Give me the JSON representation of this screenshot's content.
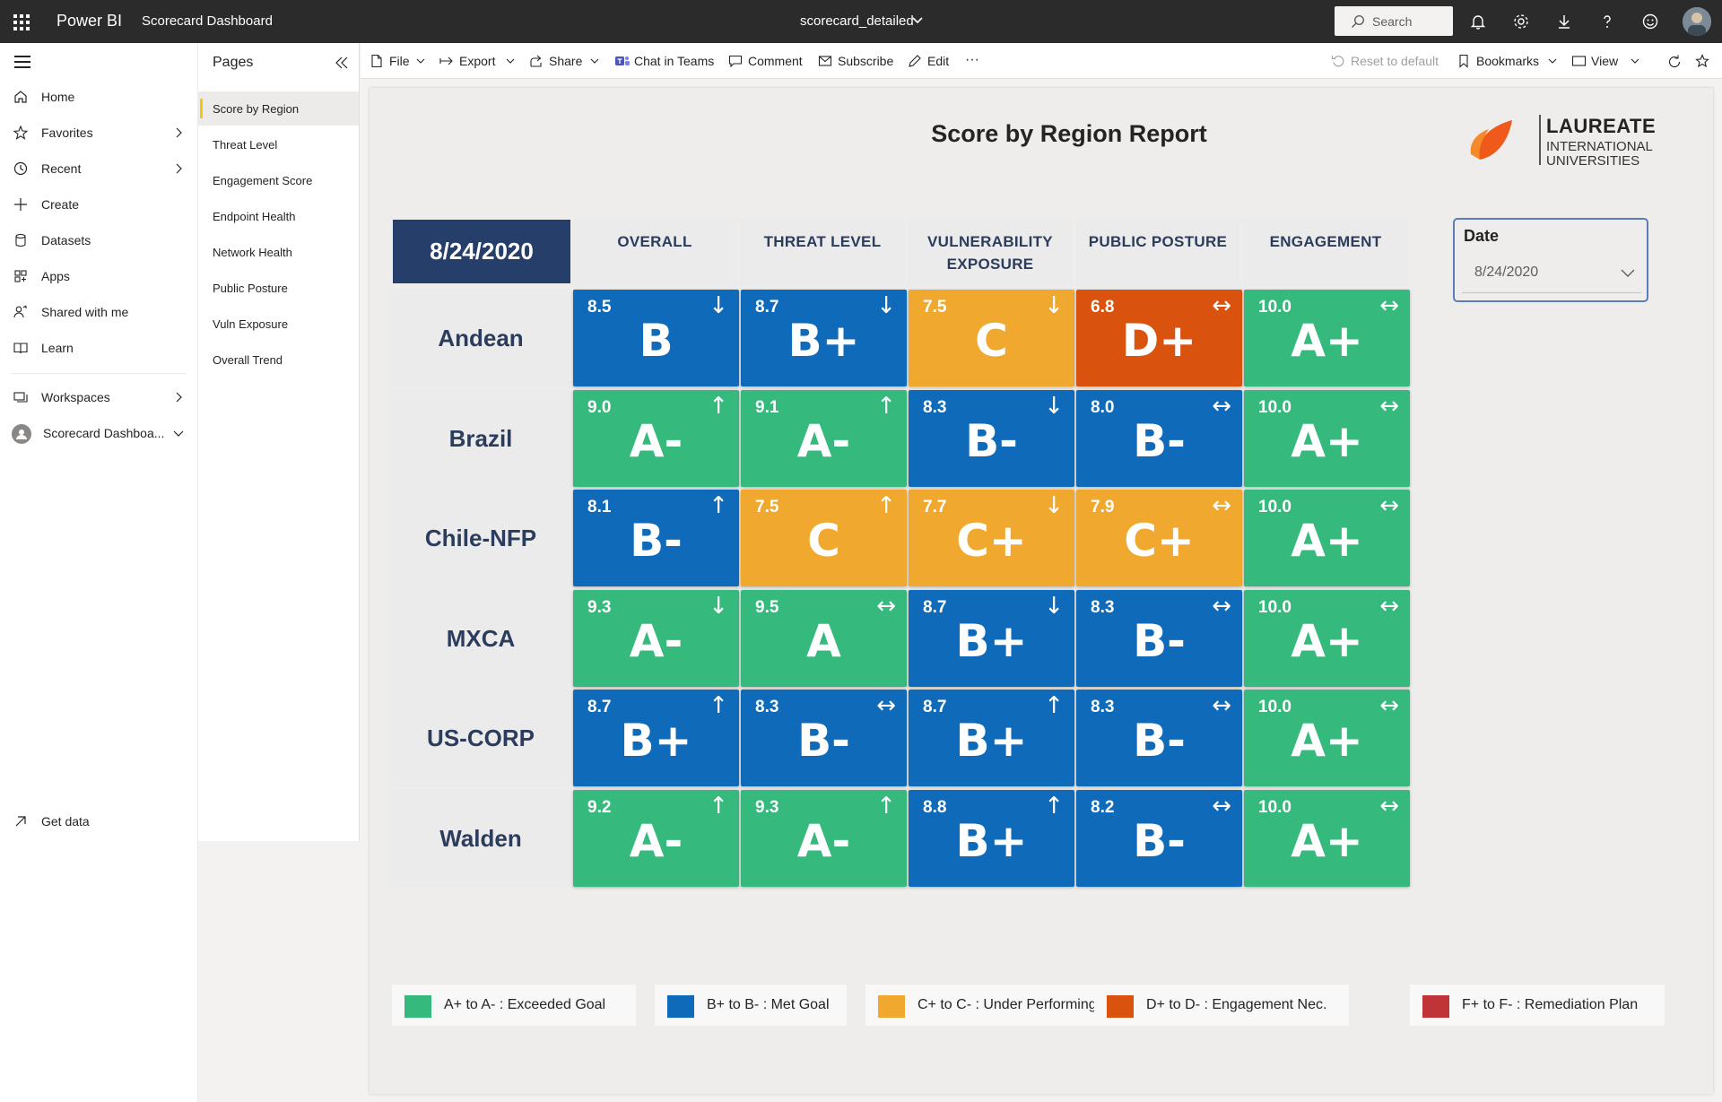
{
  "topbar": {
    "app_name": "Power BI",
    "report_title": "Scorecard Dashboard",
    "file_name": "scorecard_detailed",
    "search_placeholder": "Search"
  },
  "leftnav": {
    "items": [
      {
        "label": "Home",
        "icon": "home-icon"
      },
      {
        "label": "Favorites",
        "icon": "star-icon"
      },
      {
        "label": "Recent",
        "icon": "clock-icon"
      },
      {
        "label": "Create",
        "icon": "plus-icon"
      },
      {
        "label": "Datasets",
        "icon": "database-icon"
      },
      {
        "label": "Apps",
        "icon": "apps-icon"
      },
      {
        "label": "Shared with me",
        "icon": "shared-icon"
      },
      {
        "label": "Learn",
        "icon": "book-icon"
      },
      {
        "label": "Workspaces",
        "icon": "workspaces-icon"
      },
      {
        "label": "Scorecard Dashboa...",
        "icon": "workspace-avatar-icon"
      }
    ],
    "get_data": "Get data"
  },
  "pages": {
    "title": "Pages",
    "items": [
      "Score by Region",
      "Threat Level",
      "Engagement Score",
      "Endpoint Health",
      "Network Health",
      "Public Posture",
      "Vuln Exposure",
      "Overall Trend"
    ],
    "active": "Score by Region"
  },
  "commandbar": {
    "file": "File",
    "export": "Export",
    "share": "Share",
    "chat": "Chat in Teams",
    "comment": "Comment",
    "subscribe": "Subscribe",
    "edit": "Edit",
    "more": "···",
    "reset": "Reset to default",
    "bookmarks": "Bookmarks",
    "view": "View"
  },
  "report": {
    "heading": "Score by Region Report",
    "logo": {
      "name": "LAUREATE",
      "line1": "INTERNATIONAL",
      "line2": "UNIVERSITIES"
    },
    "date_slicer": {
      "label": "Date",
      "value": "8/24/2020"
    },
    "corner_date": "8/24/2020",
    "columns": [
      "OVERALL",
      "THREAT LEVEL",
      "VULNERABILITY EXPOSURE",
      "PUBLIC POSTURE",
      "ENGAGEMENT"
    ],
    "colors": {
      "A": "#36b97c",
      "B": "#0f6bba",
      "C": "#f0a82e",
      "D": "#d9520e",
      "F": "#c03437"
    },
    "rows": [
      {
        "region": "Andean",
        "cells": [
          {
            "score": "8.5",
            "grade": "B",
            "arrow": "↓",
            "band": "B"
          },
          {
            "score": "8.7",
            "grade": "B+",
            "arrow": "↓",
            "band": "B"
          },
          {
            "score": "7.5",
            "grade": "C",
            "arrow": "↓",
            "band": "C"
          },
          {
            "score": "6.8",
            "grade": "D+",
            "arrow": "↔",
            "band": "D"
          },
          {
            "score": "10.0",
            "grade": "A+",
            "arrow": "↔",
            "band": "A"
          }
        ]
      },
      {
        "region": "Brazil",
        "cells": [
          {
            "score": "9.0",
            "grade": "A-",
            "arrow": "↑",
            "band": "A"
          },
          {
            "score": "9.1",
            "grade": "A-",
            "arrow": "↑",
            "band": "A"
          },
          {
            "score": "8.3",
            "grade": "B-",
            "arrow": "↓",
            "band": "B"
          },
          {
            "score": "8.0",
            "grade": "B-",
            "arrow": "↔",
            "band": "B"
          },
          {
            "score": "10.0",
            "grade": "A+",
            "arrow": "↔",
            "band": "A"
          }
        ]
      },
      {
        "region": "Chile-NFP",
        "cells": [
          {
            "score": "8.1",
            "grade": "B-",
            "arrow": "↑",
            "band": "B"
          },
          {
            "score": "7.5",
            "grade": "C",
            "arrow": "↑",
            "band": "C"
          },
          {
            "score": "7.7",
            "grade": "C+",
            "arrow": "↓",
            "band": "C"
          },
          {
            "score": "7.9",
            "grade": "C+",
            "arrow": "↔",
            "band": "C"
          },
          {
            "score": "10.0",
            "grade": "A+",
            "arrow": "↔",
            "band": "A"
          }
        ]
      },
      {
        "region": "MXCA",
        "cells": [
          {
            "score": "9.3",
            "grade": "A-",
            "arrow": "↓",
            "band": "A"
          },
          {
            "score": "9.5",
            "grade": "A",
            "arrow": "↔",
            "band": "A"
          },
          {
            "score": "8.7",
            "grade": "B+",
            "arrow": "↓",
            "band": "B"
          },
          {
            "score": "8.3",
            "grade": "B-",
            "arrow": "↔",
            "band": "B"
          },
          {
            "score": "10.0",
            "grade": "A+",
            "arrow": "↔",
            "band": "A"
          }
        ]
      },
      {
        "region": "US-CORP",
        "cells": [
          {
            "score": "8.7",
            "grade": "B+",
            "arrow": "↑",
            "band": "B"
          },
          {
            "score": "8.3",
            "grade": "B-",
            "arrow": "↔",
            "band": "B"
          },
          {
            "score": "8.7",
            "grade": "B+",
            "arrow": "↑",
            "band": "B"
          },
          {
            "score": "8.3",
            "grade": "B-",
            "arrow": "↔",
            "band": "B"
          },
          {
            "score": "10.0",
            "grade": "A+",
            "arrow": "↔",
            "band": "A"
          }
        ]
      },
      {
        "region": "Walden",
        "cells": [
          {
            "score": "9.2",
            "grade": "A-",
            "arrow": "↑",
            "band": "A"
          },
          {
            "score": "9.3",
            "grade": "A-",
            "arrow": "↑",
            "band": "A"
          },
          {
            "score": "8.8",
            "grade": "B+",
            "arrow": "↑",
            "band": "B"
          },
          {
            "score": "8.2",
            "grade": "B-",
            "arrow": "↔",
            "band": "B"
          },
          {
            "score": "10.0",
            "grade": "A+",
            "arrow": "↔",
            "band": "A"
          }
        ]
      }
    ],
    "legend": [
      {
        "label": "A+ to A- : Exceeded Goal",
        "color": "#36b97c"
      },
      {
        "label": "B+ to B- : Met Goal",
        "color": "#0f6bba"
      },
      {
        "label": "C+ to C- : Under Performing",
        "color": "#f0a82e"
      },
      {
        "label": "D+ to D- : Engagement Nec.",
        "color": "#d9520e"
      },
      {
        "label": "F+ to F- : Remediation Plan",
        "color": "#c03437"
      }
    ]
  }
}
